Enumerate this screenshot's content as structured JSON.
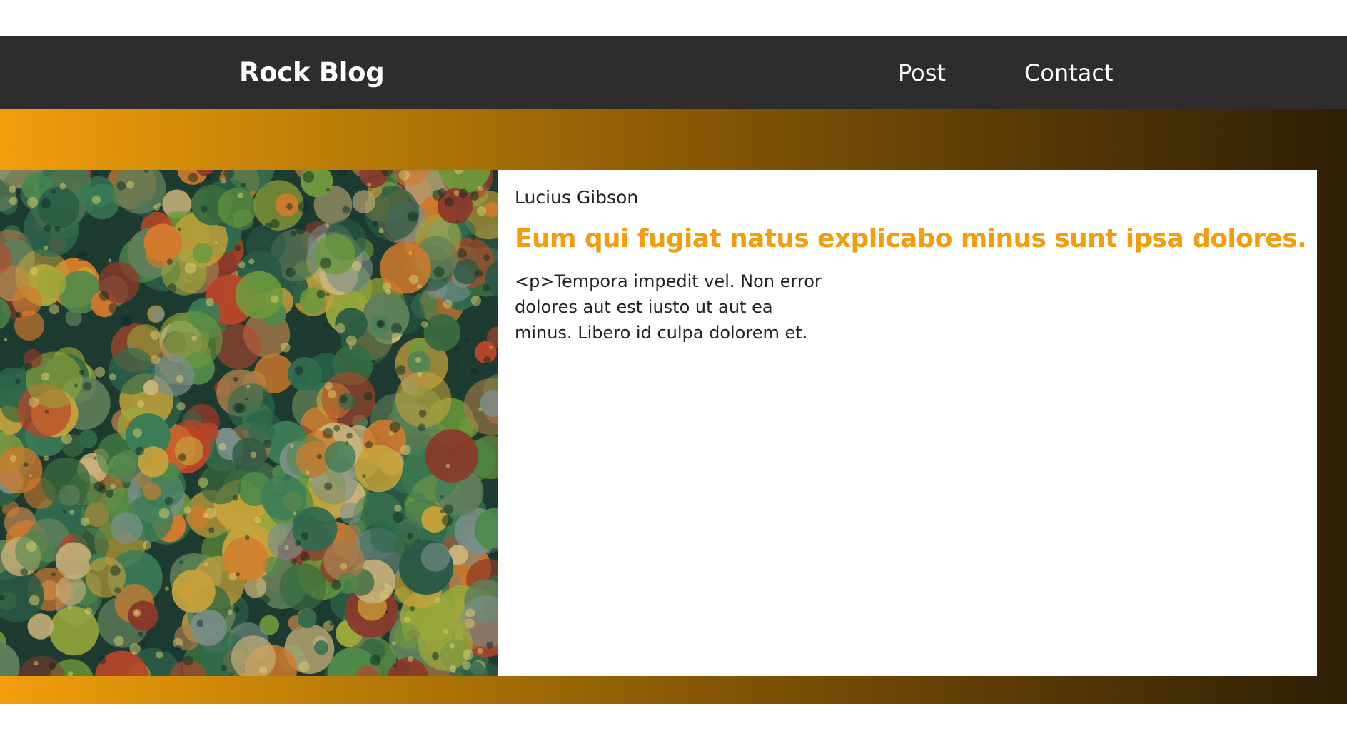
{
  "navbar": {
    "brand": "Rock Blog",
    "links": [
      {
        "label": "Post"
      },
      {
        "label": "Contact"
      }
    ],
    "background": "#2d2d2d"
  },
  "banner": {
    "gradient_start": "#f29e0c",
    "gradient_end": "#2e1f06"
  },
  "post": {
    "image_subject": "aerial view of an autumn forest",
    "author": "Lucius Gibson",
    "title": "Eum qui fugiat natus explicabo minus sunt ipsa dolores.",
    "excerpt": "<p>Tempora impedit vel. Non error dolores aut est iusto ut aut ea minus. Libero id culpa dolorem et.",
    "title_color": "#f29e0c"
  }
}
